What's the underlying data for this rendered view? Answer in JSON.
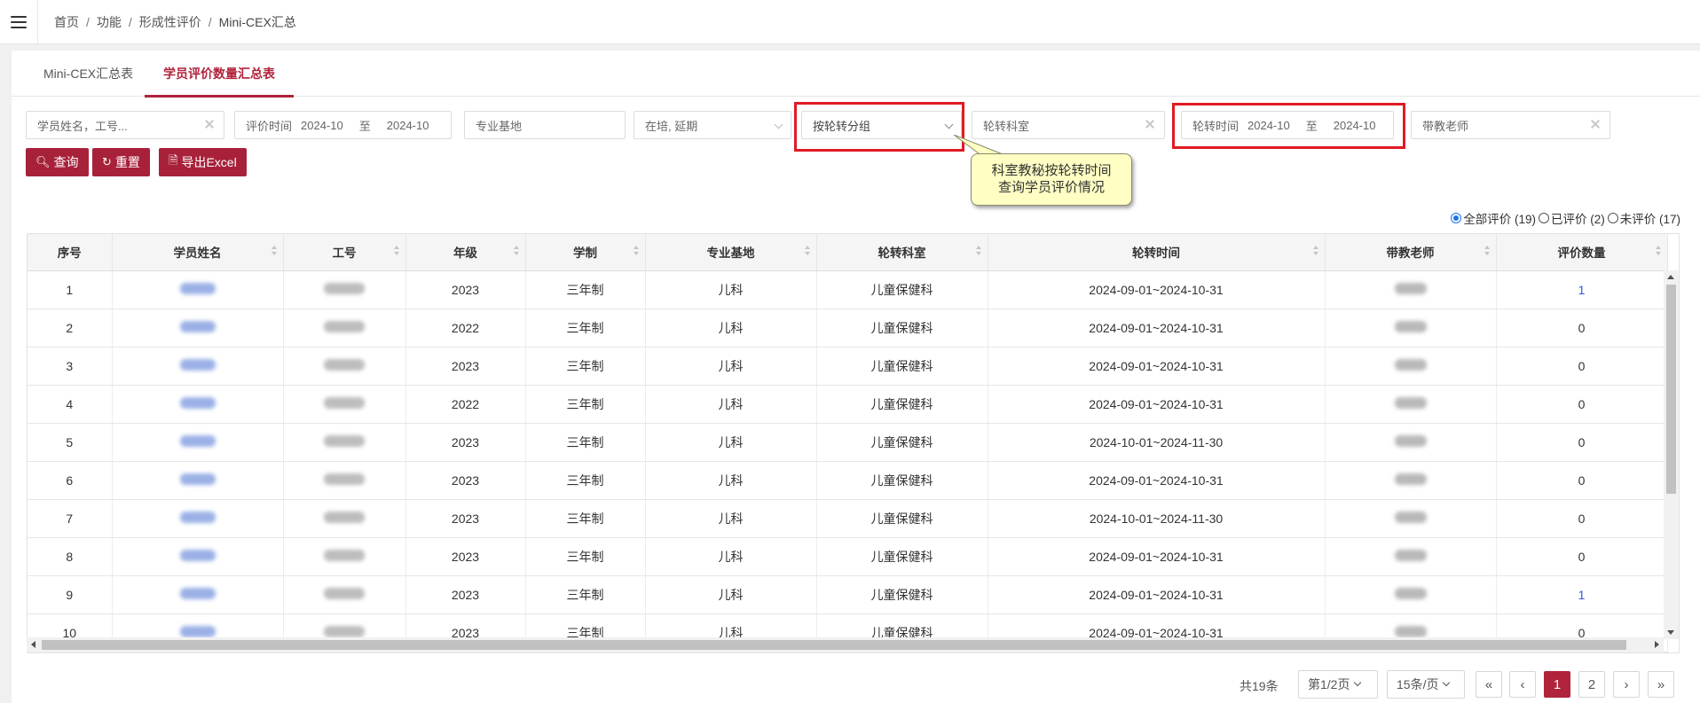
{
  "breadcrumb": [
    "首页",
    "功能",
    "形成性评价",
    "Mini-CEX汇总"
  ],
  "tabs": [
    {
      "label": "Mini-CEX汇总表",
      "active": false
    },
    {
      "label": "学员评价数量汇总表",
      "active": true
    }
  ],
  "filters": {
    "student_placeholder": "学员姓名，工号...",
    "eval_time_label": "评价时间",
    "eval_time_from": "2024-10",
    "eval_time_sep": "至",
    "eval_time_to": "2024-10",
    "base_placeholder": "专业基地",
    "status_value": "在培, 延期",
    "group_value": "按轮转分组",
    "dept_placeholder": "轮转科室",
    "rotation_time_label": "轮转时间",
    "rotation_time_from": "2024-10",
    "rotation_time_sep": "至",
    "rotation_time_to": "2024-10",
    "teacher_placeholder": "带教老师"
  },
  "buttons": {
    "query": "查询",
    "reset": "重置",
    "export": "导出Excel"
  },
  "callout": {
    "line1": "科室教秘按轮转时间",
    "line2": "查询学员评价情况"
  },
  "radios": [
    {
      "label": "全部评价 (19)",
      "checked": true
    },
    {
      "label": "已评价 (2)",
      "checked": false
    },
    {
      "label": "未评价 (17)",
      "checked": false
    }
  ],
  "table": {
    "headers": [
      "序号",
      "学员姓名",
      "工号",
      "年级",
      "学制",
      "专业基地",
      "轮转科室",
      "轮转时间",
      "带教老师",
      "评价数量"
    ],
    "rows": [
      {
        "no": "1",
        "grade": "2023",
        "system": "三年制",
        "base": "儿科",
        "dept": "儿童保健科",
        "time": "2024-09-01~2024-10-31",
        "count": "1"
      },
      {
        "no": "2",
        "grade": "2022",
        "system": "三年制",
        "base": "儿科",
        "dept": "儿童保健科",
        "time": "2024-09-01~2024-10-31",
        "count": "0"
      },
      {
        "no": "3",
        "grade": "2023",
        "system": "三年制",
        "base": "儿科",
        "dept": "儿童保健科",
        "time": "2024-09-01~2024-10-31",
        "count": "0"
      },
      {
        "no": "4",
        "grade": "2022",
        "system": "三年制",
        "base": "儿科",
        "dept": "儿童保健科",
        "time": "2024-09-01~2024-10-31",
        "count": "0"
      },
      {
        "no": "5",
        "grade": "2023",
        "system": "三年制",
        "base": "儿科",
        "dept": "儿童保健科",
        "time": "2024-10-01~2024-11-30",
        "count": "0"
      },
      {
        "no": "6",
        "grade": "2023",
        "system": "三年制",
        "base": "儿科",
        "dept": "儿童保健科",
        "time": "2024-09-01~2024-10-31",
        "count": "0"
      },
      {
        "no": "7",
        "grade": "2023",
        "system": "三年制",
        "base": "儿科",
        "dept": "儿童保健科",
        "time": "2024-10-01~2024-11-30",
        "count": "0"
      },
      {
        "no": "8",
        "grade": "2023",
        "system": "三年制",
        "base": "儿科",
        "dept": "儿童保健科",
        "time": "2024-09-01~2024-10-31",
        "count": "0"
      },
      {
        "no": "9",
        "grade": "2023",
        "system": "三年制",
        "base": "儿科",
        "dept": "儿童保健科",
        "time": "2024-09-01~2024-10-31",
        "count": "1"
      },
      {
        "no": "10",
        "grade": "2023",
        "system": "三年制",
        "base": "儿科",
        "dept": "儿童保健科",
        "time": "2024-09-01~2024-10-31",
        "count": "0"
      }
    ]
  },
  "pagination": {
    "total": "共19条",
    "page_select": "第1/2页",
    "size_select": "15条/页",
    "first": "«",
    "prev": "‹",
    "pages": [
      "1",
      "2"
    ],
    "next": "›",
    "last": "»"
  },
  "colors": {
    "accent": "#b0233b",
    "highlight": "#e01b24",
    "callout_bg": "#ffffc4",
    "link": "#2a5bd7"
  }
}
